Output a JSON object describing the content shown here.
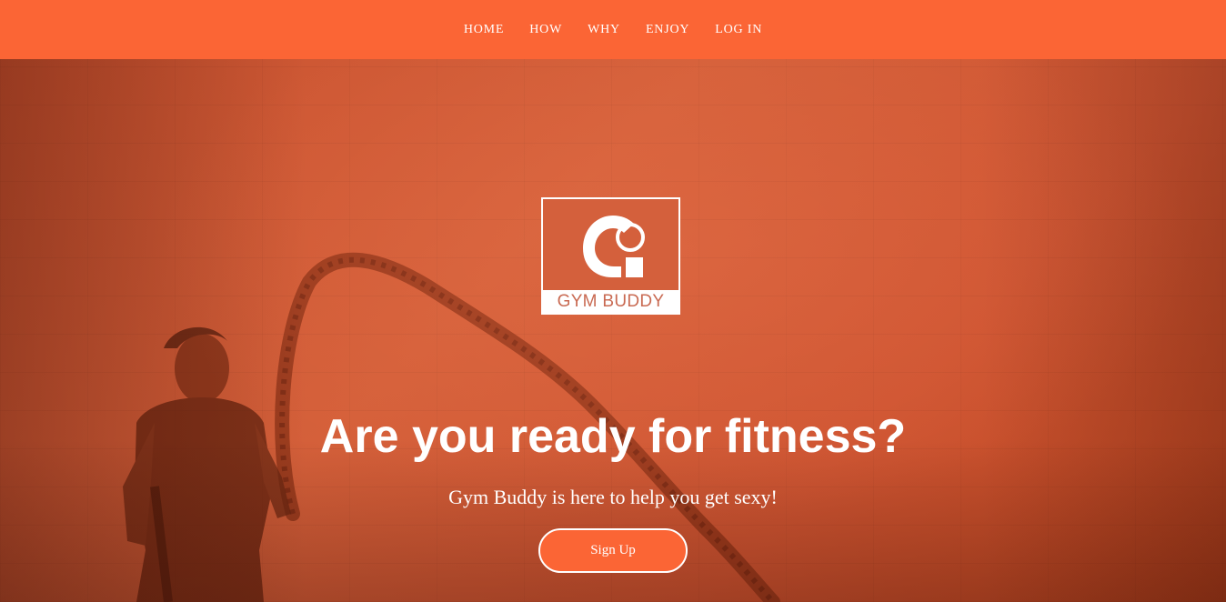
{
  "nav": {
    "items": [
      {
        "label": "HOME"
      },
      {
        "label": "HOW"
      },
      {
        "label": "WHY"
      },
      {
        "label": "ENJOY"
      },
      {
        "label": "LOG IN"
      }
    ]
  },
  "logo": {
    "caption": "GYM BUDDY",
    "icon": "gym-buddy-g-logo"
  },
  "hero": {
    "headline": "Are you ready for fitness?",
    "subheadline": "Gym Buddy is here to help you get sexy!",
    "cta_label": "Sign Up"
  },
  "colors": {
    "accent": "#fb6535",
    "overlay": "#d15a35",
    "text": "#ffffff"
  }
}
